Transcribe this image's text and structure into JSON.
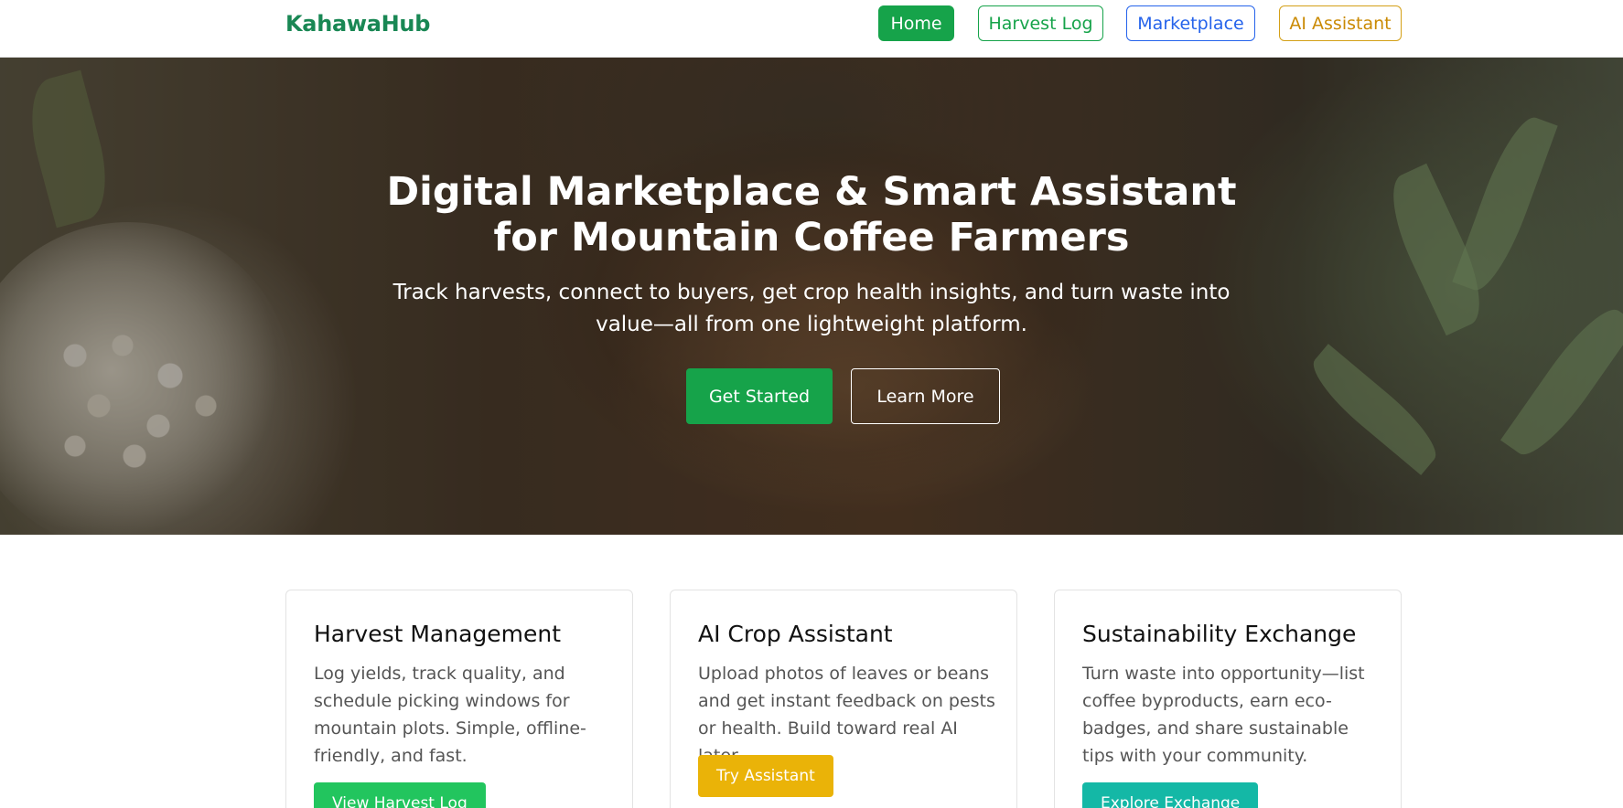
{
  "navbar": {
    "brand": "KahawaHub",
    "items": [
      {
        "label": "Home",
        "active": true
      },
      {
        "label": "Harvest Log"
      },
      {
        "label": "Marketplace"
      },
      {
        "label": "AI Assistant"
      }
    ]
  },
  "hero": {
    "title": "Digital Marketplace & Smart Assistant for Mountain Coffee Farmers",
    "subtitle": "Track harvests, connect to buyers, get crop health insights, and turn waste into value—all from one lightweight platform.",
    "primary_button": "Get Started",
    "secondary_button": "Learn More"
  },
  "cards": [
    {
      "title": "Harvest Management",
      "text": "Log yields, track quality, and schedule picking windows for mountain plots. Simple, offline-friendly, and fast.",
      "button": "View Harvest Log"
    },
    {
      "title": "AI Crop Assistant",
      "text": "Upload photos of leaves or beans and get instant feedback on pests or health. Build toward real AI later.",
      "button": "Try Assistant"
    },
    {
      "title": "Sustainability Exchange",
      "text": "Turn waste into opportunity—list coffee byproducts, earn eco-badges, and share sustainable tips with your community.",
      "button": "Explore Exchange"
    }
  ],
  "colors": {
    "brand": "#198754",
    "primary": "#16a34a",
    "marketplace": "#2563eb",
    "assistant": "#ca8a04",
    "exchange": "#14b8a6"
  }
}
